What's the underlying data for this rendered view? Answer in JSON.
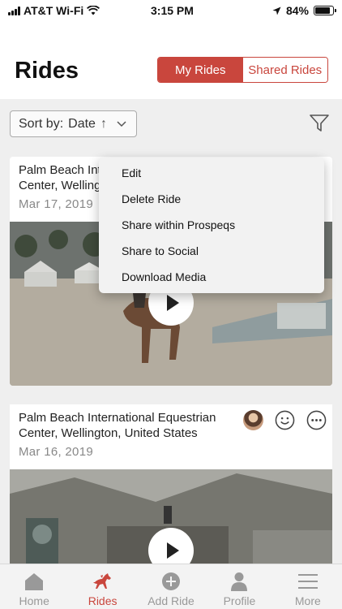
{
  "status_bar": {
    "carrier": "AT&T Wi-Fi",
    "time": "3:15 PM",
    "battery": "84%",
    "battery_level": 0.84
  },
  "header": {
    "title": "Rides",
    "segments": [
      {
        "label": "My Rides",
        "active": true
      },
      {
        "label": "Shared Rides",
        "active": false
      }
    ]
  },
  "sort": {
    "label": "Sort by:",
    "value": "Date",
    "direction_glyph": "↑"
  },
  "rides": [
    {
      "title_line1": "Palm Beach International Equestrian",
      "title_line2": "Center, Wellington, United States",
      "date": "Mar 17, 2019"
    },
    {
      "title_line1": "Palm Beach International Equestrian",
      "title_line2": "Center, Wellington, United States",
      "date": "Mar 16, 2019"
    }
  ],
  "context_menu": {
    "items": [
      "Edit",
      "Delete Ride",
      "Share within Prospeqs",
      "Share to Social",
      "Download Media"
    ]
  },
  "tab_bar": {
    "items": [
      {
        "label": "Home",
        "icon": "home-icon",
        "active": false
      },
      {
        "label": "Rides",
        "icon": "horse-icon",
        "active": true
      },
      {
        "label": "Add Ride",
        "icon": "plus-circle-icon",
        "active": false
      },
      {
        "label": "Profile",
        "icon": "person-icon",
        "active": false
      },
      {
        "label": "More",
        "icon": "menu-icon",
        "active": false
      }
    ]
  },
  "colors": {
    "accent": "#c9463d",
    "inactive_tab": "#999999"
  }
}
